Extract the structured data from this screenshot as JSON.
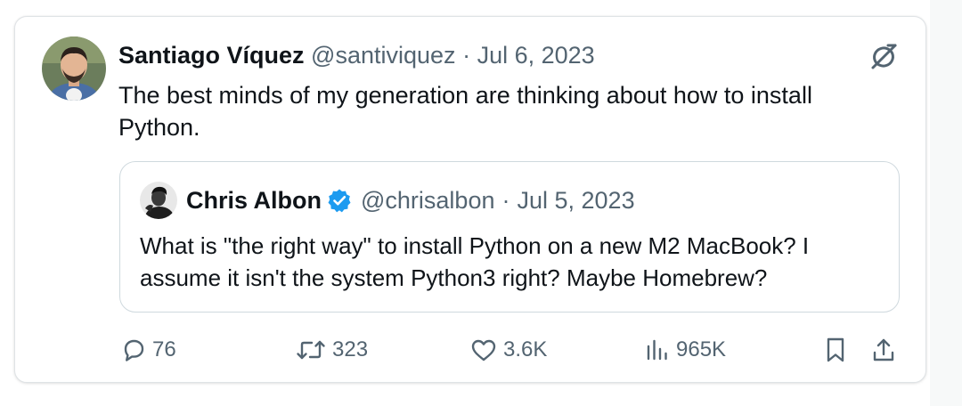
{
  "tweet": {
    "author_name": "Santiago Víquez",
    "handle": "@santiviquez",
    "separator": "·",
    "date": "Jul 6, 2023",
    "text": "The best minds of my generation are thinking about how to install Python."
  },
  "quoted_tweet": {
    "author_name": "Chris Albon",
    "verified": true,
    "handle": "@chrisalbon",
    "separator": "·",
    "date": "Jul 5, 2023",
    "text": "What is \"the right way\" to install Python on a new M2 MacBook? I assume it isn't the system Python3 right? Maybe Homebrew?"
  },
  "actions": {
    "replies": "76",
    "retweets": "323",
    "likes": "3.6K",
    "views": "965K"
  },
  "icons": {
    "header_right": "grok-icon",
    "reply": "reply-icon",
    "retweet": "retweet-icon",
    "like": "heart-icon",
    "views": "views-icon",
    "bookmark": "bookmark-icon",
    "share": "share-icon"
  },
  "colors": {
    "text": "#0f1419",
    "secondary": "#536471",
    "verified": "#1d9bf0",
    "border": "#cfd9de"
  }
}
